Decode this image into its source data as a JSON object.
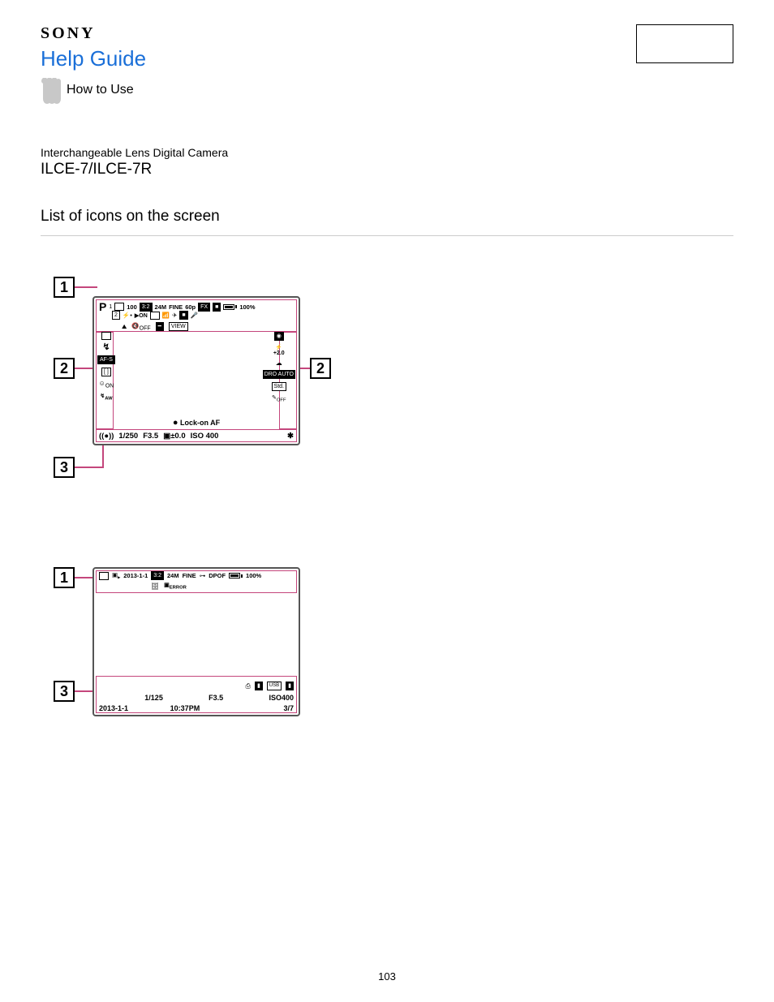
{
  "header": {
    "brand": "SONY",
    "help_guide": "Help Guide",
    "how_to_use": "How to Use"
  },
  "product": {
    "super": "Interchangeable Lens Digital Camera",
    "model": "ILCE-7/ILCE-7R"
  },
  "page_title": "List of icons on the screen",
  "page_number": "103",
  "callouts": {
    "n1": "1",
    "n2": "2",
    "n3": "3"
  },
  "fig1": {
    "top": {
      "mode": "P",
      "card_slot": "1",
      "remaining": "100",
      "aspect": "3:2",
      "size": "24M",
      "quality": "FINE",
      "fps": "60p",
      "rec_fmt1": "FX",
      "battery_pct": "100%",
      "row2_a": "2",
      "row2_b": "ON",
      "row3_off": "OFF",
      "row3_view": "VIEW"
    },
    "left_stack": {
      "drive": "□",
      "flash": "↯",
      "af": "AF-S",
      "meter": "[ ]",
      "steady": "ON",
      "wb": "WB AW"
    },
    "right_stack": {
      "disp": "◉",
      "ev": "+2.0",
      "cloud": "▲",
      "dro": "DRO\nAUTO",
      "std": "Std.",
      "off": "OFF"
    },
    "mid_label": "Lock-on AF",
    "bottom": {
      "ss": "1/250",
      "f": "F3.5",
      "ev": "±0.0",
      "iso": "ISO 400",
      "star": "✱"
    }
  },
  "fig2": {
    "top": {
      "date": "2013-1-1",
      "aspect": "3:2",
      "size": "24M",
      "quality": "FINE",
      "protect": "⊶",
      "dpof": "DPOF",
      "battery_pct": "100%",
      "error": "ERROR"
    },
    "bot": {
      "date": "2013-1-1",
      "ss": "1/125",
      "time": "10:37PM",
      "f": "F3.5",
      "iso": "ISO400",
      "counter": "3/7"
    }
  }
}
